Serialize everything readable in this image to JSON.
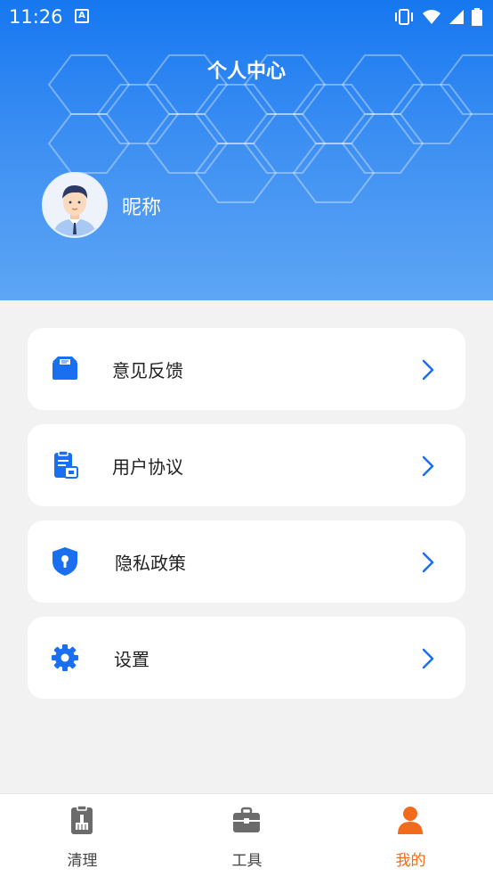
{
  "status_bar": {
    "time": "11:26",
    "notification_icon": "A"
  },
  "header": {
    "title": "个人中心",
    "nickname": "昵称"
  },
  "menu": [
    {
      "label": "意见反馈",
      "icon": "feedback-icon"
    },
    {
      "label": "用户协议",
      "icon": "agreement-icon"
    },
    {
      "label": "隐私政策",
      "icon": "privacy-shield-icon"
    },
    {
      "label": "设置",
      "icon": "gear-icon"
    }
  ],
  "tabbar": {
    "tabs": [
      {
        "label": "清理",
        "icon": "clean-icon",
        "active": false
      },
      {
        "label": "工具",
        "icon": "toolbox-icon",
        "active": false
      },
      {
        "label": "我的",
        "icon": "profile-icon",
        "active": true
      }
    ]
  },
  "colors": {
    "primary": "#1a6ff0",
    "active_tab": "#f26a1b",
    "header_top": "#1677f0",
    "header_bottom": "#5ea6f5"
  }
}
